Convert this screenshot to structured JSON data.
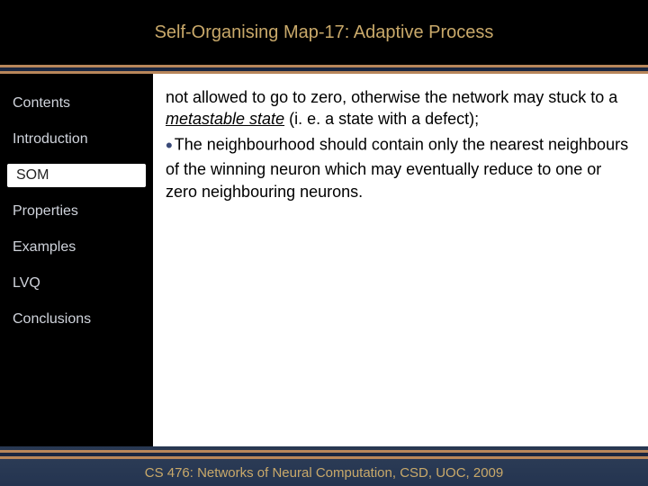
{
  "header": {
    "title": "Self-Organising Map-17: Adaptive Process"
  },
  "sidebar": {
    "items": [
      {
        "label": "Contents",
        "active": false
      },
      {
        "label": "Introduction",
        "active": false
      },
      {
        "label": "SOM",
        "active": true
      },
      {
        "label": "Properties",
        "active": false
      },
      {
        "label": "Examples",
        "active": false
      },
      {
        "label": "LVQ",
        "active": false
      },
      {
        "label": "Conclusions",
        "active": false
      }
    ]
  },
  "content": {
    "p1_a": "not allowed to go to zero, otherwise the network may stuck to a ",
    "p1_em": "metastable state",
    "p1_b": " (i. e. a state with a defect);",
    "p2": "The neighbourhood should contain only the nearest neighbours of the winning neuron which may eventually reduce to one or zero neighbouring neurons."
  },
  "footer": {
    "text": "CS 476: Networks of Neural Computation, CSD, UOC, 2009"
  }
}
